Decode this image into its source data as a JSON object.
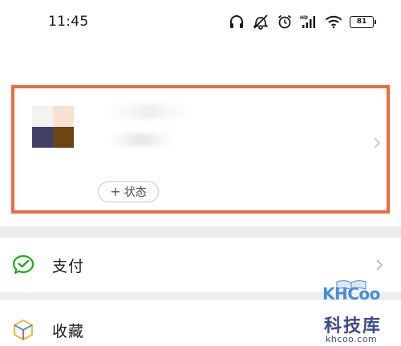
{
  "status_bar": {
    "time": "11:45",
    "battery": "81",
    "icons": [
      "headphones-icon",
      "vibrate-off-icon",
      "alarm-icon",
      "hd-signal-icon",
      "wifi-icon",
      "battery-icon"
    ]
  },
  "profile": {
    "highlight_color": "#ee6b3f",
    "status_button": {
      "plus": "+",
      "label": "状态"
    }
  },
  "menu": {
    "items": [
      {
        "label": "支付",
        "icon": "wechat-pay-icon",
        "icon_color": "#1aad19"
      },
      {
        "label": "收藏",
        "icon": "favorites-cube-icon",
        "icon_color": "#f0b640"
      }
    ]
  },
  "watermark": {
    "logo": "KHCoo",
    "text": "科技库",
    "url": "khcoo.com"
  }
}
